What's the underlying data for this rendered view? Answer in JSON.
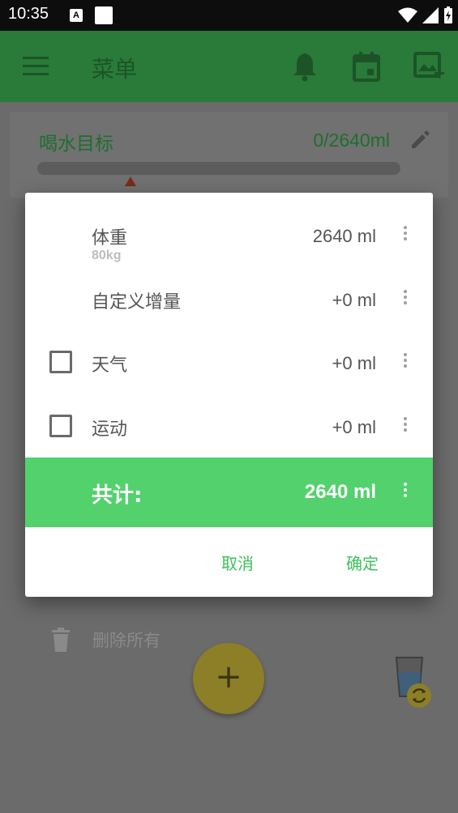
{
  "status_bar": {
    "time": "10:35",
    "notif_badge": "A"
  },
  "app_bar": {
    "title": "菜单",
    "icons": [
      "menu-icon",
      "bell-icon",
      "calendar-icon",
      "add-photo-icon"
    ],
    "color": "#2a7a39"
  },
  "goal_card": {
    "label": "喝水目标",
    "amount": "0/2640ml",
    "progress": 0
  },
  "dialog": {
    "rows": [
      {
        "name": "体重",
        "sub": "80kg",
        "value": "2640 ml",
        "checkbox": false
      },
      {
        "name": "自定义增量",
        "value": "+0 ml",
        "checkbox": false
      },
      {
        "name": "天气",
        "value": "+0 ml",
        "checkbox": true,
        "checked": false
      },
      {
        "name": "运动",
        "value": "+0 ml",
        "checkbox": true,
        "checked": false
      }
    ],
    "total": {
      "name": "共计:",
      "value": "2640 ml",
      "color": "#53d16d"
    },
    "cancel_label": "取消",
    "confirm_label": "确定"
  },
  "delete_all_label": "删除所有",
  "fab_label": "+"
}
